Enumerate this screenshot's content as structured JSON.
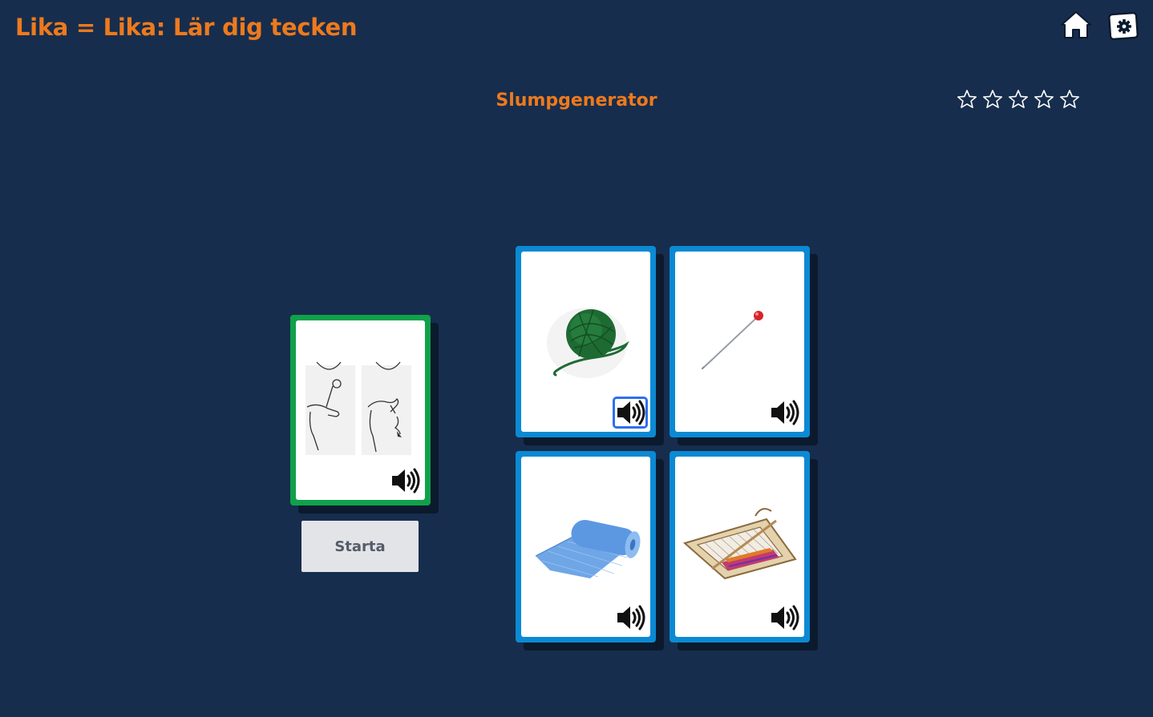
{
  "app": {
    "title": "Lika = Lika: Lär dig tecken"
  },
  "toolbar": {
    "home_icon": "home-icon",
    "settings_icon": "settings-gear-icon"
  },
  "game": {
    "mode_title": "Slumpgenerator",
    "stars": {
      "earned": 0,
      "total": 5
    },
    "sign_card": {
      "image": "sign-language-illustration",
      "sound_icon": "speaker-icon"
    },
    "start_label": "Starta",
    "choices": [
      {
        "image": "green-yarn-ball",
        "sound_icon": "speaker-icon"
      },
      {
        "image": "pin-needle",
        "sound_icon": "speaker-icon"
      },
      {
        "image": "blue-fabric-roll",
        "sound_icon": "speaker-icon"
      },
      {
        "image": "weaving-loom",
        "sound_icon": "speaker-icon"
      }
    ]
  },
  "colors": {
    "background": "#172d4d",
    "accent_orange": "#ed7a1d",
    "sign_card_border": "#10a14a",
    "choice_card_border": "#0b8ad3",
    "focus_ring": "#2f6ff0"
  }
}
